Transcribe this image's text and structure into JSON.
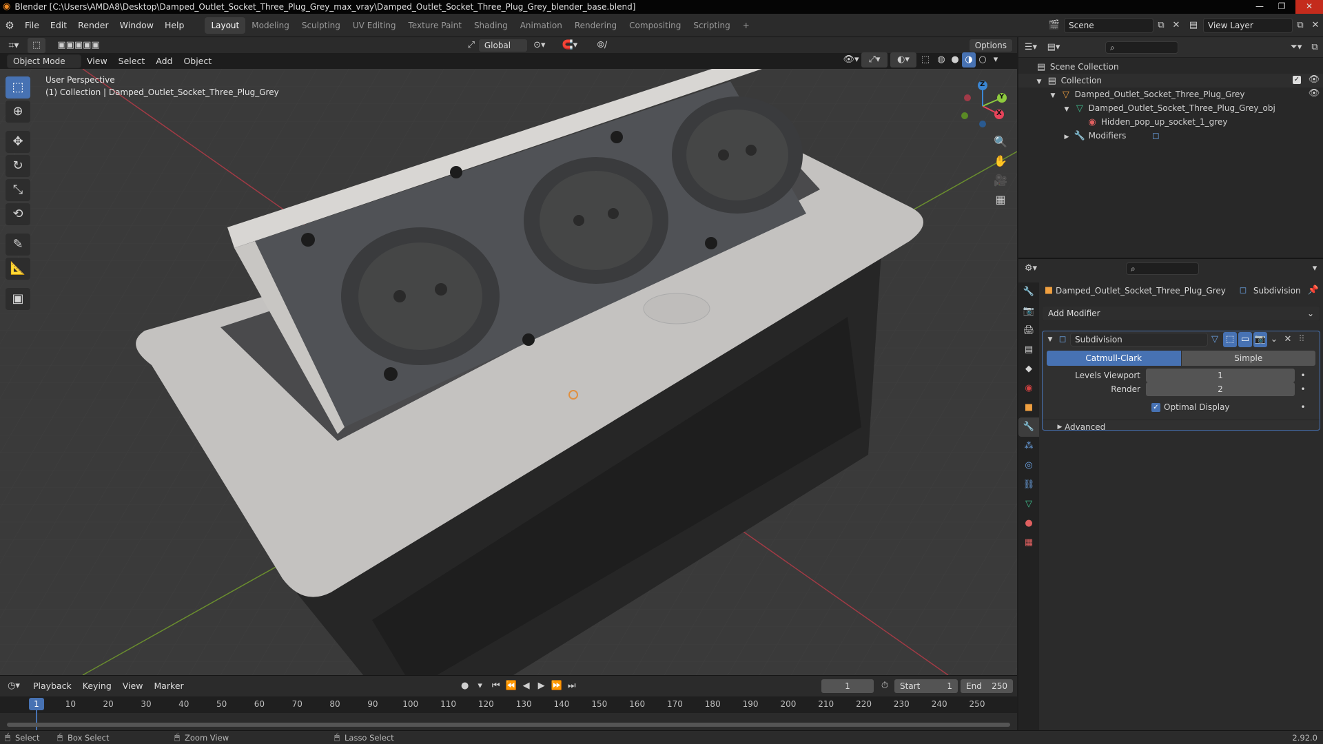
{
  "window": {
    "title": "Blender [C:\\Users\\AMDA8\\Desktop\\Damped_Outlet_Socket_Three_Plug_Grey_max_vray\\Damped_Outlet_Socket_Three_Plug_Grey_blender_base.blend]",
    "min": "—",
    "max": "❐",
    "close": "✕"
  },
  "menu": [
    "File",
    "Edit",
    "Render",
    "Window",
    "Help"
  ],
  "workspaces": [
    "Layout",
    "Modeling",
    "Sculpting",
    "UV Editing",
    "Texture Paint",
    "Shading",
    "Animation",
    "Rendering",
    "Compositing",
    "Scripting",
    "+"
  ],
  "scene": {
    "name": "Scene",
    "view_layer": "View Layer"
  },
  "viewport": {
    "orientation": "Global",
    "options": "Options",
    "mode": "Object Mode",
    "menus": [
      "View",
      "Select",
      "Add",
      "Object"
    ],
    "info_line1": "User Perspective",
    "info_line2": "(1) Collection | Damped_Outlet_Socket_Three_Plug_Grey",
    "gizmo": {
      "x": "X",
      "y": "Y",
      "z": "Z"
    }
  },
  "outliner": {
    "root": "Scene Collection",
    "collection": "Collection",
    "object": "Damped_Outlet_Socket_Three_Plug_Grey",
    "mesh": "Damped_Outlet_Socket_Three_Plug_Grey_obj",
    "material": "Hidden_pop_up_socket_1_grey",
    "modifiers": "Modifiers"
  },
  "properties": {
    "breadcrumb_object": "Damped_Outlet_Socket_Three_Plug_Grey",
    "breadcrumb_modifier": "Subdivision",
    "add_modifier": "Add Modifier",
    "modifier_name": "Subdivision",
    "mode_a": "Catmull-Clark",
    "mode_b": "Simple",
    "levels_label": "Levels Viewport",
    "levels_value": "1",
    "render_label": "Render",
    "render_value": "2",
    "optimal_display": "Optimal Display",
    "advanced": "Advanced"
  },
  "timeline": {
    "menus": [
      "Playback",
      "Keying",
      "View",
      "Marker"
    ],
    "current_frame": "1",
    "start_label": "Start",
    "start_value": "1",
    "end_label": "End",
    "end_value": "250",
    "ticks": [
      "10",
      "20",
      "30",
      "40",
      "50",
      "60",
      "70",
      "80",
      "90",
      "100",
      "110",
      "120",
      "130",
      "140",
      "150",
      "160",
      "170",
      "180",
      "190",
      "200",
      "210",
      "220",
      "230",
      "240",
      "250"
    ],
    "playhead": "1"
  },
  "statusbar": {
    "select": "Select",
    "box_select": "Box Select",
    "zoom_view": "Zoom View",
    "lasso_select": "Lasso Select",
    "version": "2.92.0"
  },
  "colors": {
    "accent": "#4772b3",
    "x_axis": "#e8435a",
    "y_axis": "#8ecb3e",
    "z_axis": "#3a86d4"
  }
}
